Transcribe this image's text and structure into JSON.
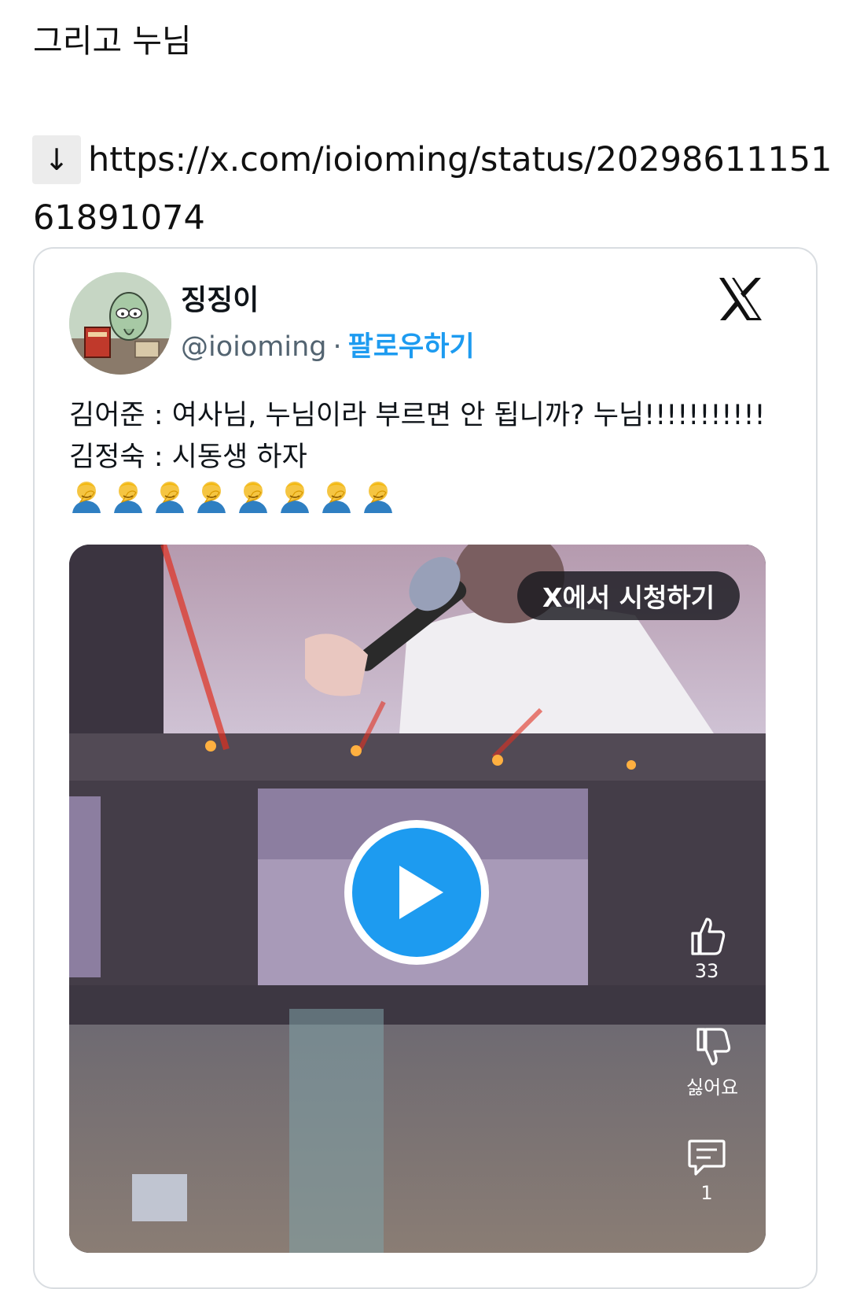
{
  "post": {
    "text": "그리고 누님",
    "arrow": "↓",
    "link_line1": "https://x.com/ioioming/status/20298611151",
    "link_line2": "61891074"
  },
  "embed": {
    "author_name": "징징이",
    "handle": "@ioioming",
    "separator": "·",
    "follow_label": "팔로우하기",
    "tweet_lines": [
      "김어준 : 여사님, 누님이라 부르면 안 됩니까? 누님!!!!!!!!!!!",
      "김정숙 : 시동생 하자"
    ],
    "emoji_icon": "facepalm-emoji",
    "emoji_count": 8,
    "media": {
      "watch_label": "X에서 시청하기",
      "play_icon": "play-icon",
      "like_count": "33",
      "dislike_label": "싫어요",
      "comment_count": "1"
    },
    "colors": {
      "accent": "#1d9bf0",
      "handle": "#536471",
      "border": "#d9dde1"
    }
  }
}
